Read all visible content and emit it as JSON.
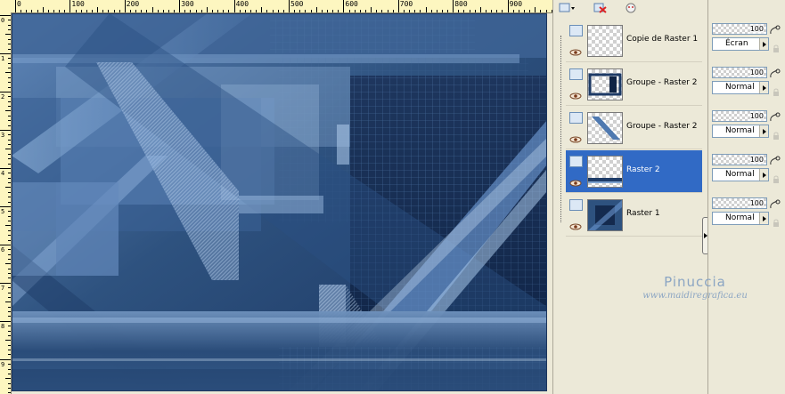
{
  "ruler": {
    "top_labels": [
      "0",
      "100",
      "200",
      "300",
      "400",
      "500",
      "600",
      "700",
      "800",
      "900"
    ],
    "left_labels": [
      "0",
      "1",
      "2",
      "3",
      "4",
      "5",
      "6",
      "7",
      "8",
      "9"
    ]
  },
  "layers": [
    {
      "name": "Copie de Raster 1",
      "selected": false,
      "thumb": "transparent"
    },
    {
      "name": "Groupe - Raster 2",
      "selected": false,
      "thumb": "frame"
    },
    {
      "name": "Groupe - Raster 2",
      "selected": false,
      "thumb": "diagonal"
    },
    {
      "name": "Raster 2",
      "selected": true,
      "thumb": "bottom-band"
    },
    {
      "name": "Raster 1",
      "selected": false,
      "thumb": "artwork"
    }
  ],
  "properties": [
    {
      "opacity": "100",
      "blend": "Écran"
    },
    {
      "opacity": "100",
      "blend": "Normal"
    },
    {
      "opacity": "100",
      "blend": "Normal"
    },
    {
      "opacity": "100",
      "blend": "Normal"
    },
    {
      "opacity": "100",
      "blend": "Normal"
    }
  ],
  "watermark": {
    "name": "Pinuccia",
    "url": "www.maidiregrafica.eu"
  },
  "colors": {
    "selection": "#316ac5",
    "panel": "#ece9d8",
    "ruler": "#fdf6c0",
    "artwork_dark": "#142a4e",
    "artwork_light": "#7fa9d6"
  },
  "icons": {
    "toolbar": [
      "new-layer-icon",
      "delete-layer-icon",
      "mask-icon"
    ],
    "layer_visibility": "eye-icon",
    "link": "link-icon",
    "lock": "lock-icon"
  }
}
